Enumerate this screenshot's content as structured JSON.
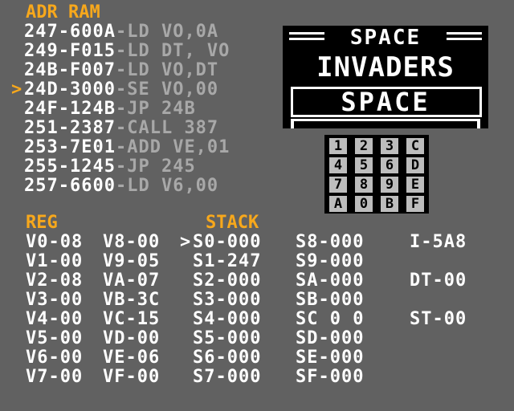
{
  "ram": {
    "header": "ADR RAM",
    "cursor_glyph": ">",
    "rows": [
      {
        "addr": "247-600A",
        "op": "-LD VO,0A",
        "current": false
      },
      {
        "addr": "249-F015",
        "op": "-LD DT, VO",
        "current": false
      },
      {
        "addr": "24B-F007",
        "op": "-LD VO,DT",
        "current": false
      },
      {
        "addr": "24D-3000",
        "op": "-SE VO,00",
        "current": true
      },
      {
        "addr": "24F-124B",
        "op": "-JP 24B",
        "current": false
      },
      {
        "addr": "251-2387",
        "op": "-CALL 387",
        "current": false
      },
      {
        "addr": "253-7E01",
        "op": "-ADD VE,01",
        "current": false
      },
      {
        "addr": "255-1245",
        "op": "-JP 245",
        "current": false
      },
      {
        "addr": "257-6600",
        "op": "-LD V6,00",
        "current": false
      }
    ]
  },
  "display": {
    "line1": "SPACE",
    "line2": "INVADERS",
    "line3": "SPACE"
  },
  "keypad": {
    "keys": [
      "1",
      "2",
      "3",
      "C",
      "4",
      "5",
      "6",
      "D",
      "7",
      "8",
      "9",
      "E",
      "A",
      "0",
      "B",
      "F"
    ]
  },
  "registers": {
    "header": "REG",
    "col1": [
      "V0-08",
      "V1-00",
      "V2-08",
      "V3-00",
      "V4-00",
      "V5-00",
      "V6-00",
      "V7-00"
    ],
    "col2": [
      "V8-00",
      "V9-05",
      "VA-07",
      "VB-3C",
      "VC-15",
      "VD-00",
      "VE-06",
      "VF-00"
    ]
  },
  "stack": {
    "header": "STACK",
    "cursor_glyph": ">",
    "col1": [
      "S0-000",
      "S1-247",
      "S2-000",
      "S3-000",
      "S4-000",
      "S5-000",
      "S6-000",
      "S7-000"
    ],
    "col2": [
      "S8-000",
      "S9-000",
      "SA-000",
      "SB-000",
      "SC 0 0",
      "SD-000",
      "SE-000",
      "SF-000"
    ]
  },
  "special": {
    "i": "I-5A8",
    "dt": "DT-00",
    "st": "ST-00"
  },
  "colors": {
    "background": "#616161",
    "accent": "#f7a81c",
    "text": "#ffffff",
    "dim_text": "#a8a8a8"
  }
}
